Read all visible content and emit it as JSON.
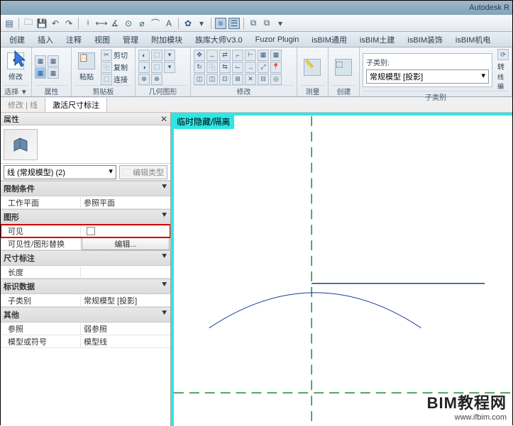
{
  "title": "Autodesk R",
  "qat_icons": [
    "menu",
    "open",
    "save",
    "undo",
    "redo",
    "print",
    "dim1",
    "dim2",
    "dim3",
    "angle",
    "text",
    "gear",
    "help",
    "filter1",
    "filter2",
    "copy",
    "paste"
  ],
  "menu_tabs": [
    "创建",
    "插入",
    "注释",
    "视图",
    "管理",
    "附加模块",
    "族库大师V3.0",
    "Fuzor Plugin",
    "isBIM通用",
    "isBIM土建",
    "isBIM装饰",
    "isBIM机电"
  ],
  "ribbon": {
    "select": {
      "big_label": "修改",
      "title": "选择 ▼"
    },
    "props": {
      "title": "属性"
    },
    "clip": {
      "title": "剪贴板",
      "paste": "粘贴",
      "cut": "剪切",
      "copy": "复制",
      "match": "连接"
    },
    "geom": {
      "title": "几何图形"
    },
    "modify": {
      "title": "修改"
    },
    "measure": {
      "title": "测量"
    },
    "create": {
      "title": "创建"
    },
    "subcat": {
      "title": "子类别",
      "label": "子类别:",
      "value": "常规模型 [投影]"
    }
  },
  "doc_tabs": {
    "t1": "修改 | 线",
    "t2": "激活尺寸标注"
  },
  "properties": {
    "title": "属性",
    "selector": "线 (常规模型) (2)",
    "edit_type": "编辑类型",
    "sections": {
      "constraints": {
        "label": "限制条件",
        "rows": [
          {
            "k": "工作平面",
            "v": "参照平面"
          }
        ]
      },
      "graphics": {
        "label": "图形",
        "rows": [
          {
            "k": "可见",
            "v": "",
            "chk": true
          },
          {
            "k": "可见性/图形替换",
            "v": "编辑...",
            "btn": true
          }
        ]
      },
      "dim": {
        "label": "尺寸标注",
        "rows": [
          {
            "k": "长度",
            "v": ""
          }
        ]
      },
      "ident": {
        "label": "标识数据",
        "rows": [
          {
            "k": "子类别",
            "v": "常规模型 [投影]"
          }
        ]
      },
      "other": {
        "label": "其他",
        "rows": [
          {
            "k": "参照",
            "v": "弱参照"
          },
          {
            "k": "模型或符号",
            "v": "模型线"
          }
        ]
      }
    }
  },
  "canvas": {
    "badge": "临时隐藏/隔离"
  },
  "watermark": {
    "big": "BIM教程网",
    "url": "www.ifbim.com"
  }
}
